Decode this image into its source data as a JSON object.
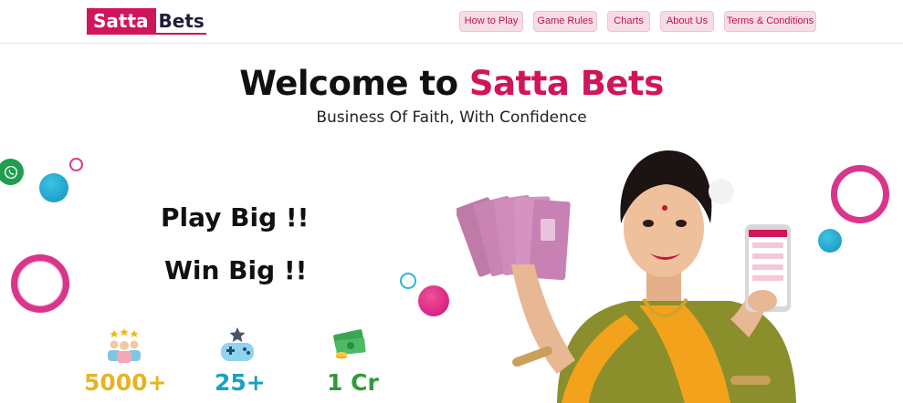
{
  "brand": {
    "part1": "Satta",
    "part2": "Bets",
    "color": "#d0155a"
  },
  "nav": {
    "items": [
      {
        "label": "How to Play"
      },
      {
        "label": "Game Rules"
      },
      {
        "label": "Charts"
      },
      {
        "label": "About Us"
      },
      {
        "label": "Terms & Conditions"
      }
    ]
  },
  "hero": {
    "title_prefix": "Welcome to ",
    "title_accent": "Satta Bets",
    "subtitle": "Business Of Faith, With Confidence",
    "tagline1": "Play Big !!",
    "tagline2": "Win Big !!"
  },
  "stats": [
    {
      "value": "5000+",
      "icon": "users-stars-icon",
      "color": "#e6b422"
    },
    {
      "value": "25+",
      "icon": "gamepad-star-icon",
      "color": "#1b9fc4"
    },
    {
      "value": "1 Cr",
      "icon": "money-stack-icon",
      "color": "#2e9a3a"
    }
  ],
  "icons": {
    "whatsapp": "whatsapp-icon"
  }
}
